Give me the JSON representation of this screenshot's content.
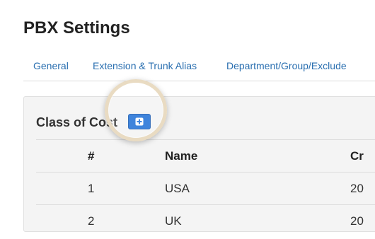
{
  "page": {
    "title": "PBX Settings"
  },
  "tabs": [
    {
      "label": "General"
    },
    {
      "label": "Extension & Trunk Alias"
    },
    {
      "label": "Department/Group/Exclude"
    }
  ],
  "panel": {
    "title": "Class of Cost",
    "add_button_icon": "plus-square-icon"
  },
  "table": {
    "headers": [
      "#",
      "Name",
      "Cr"
    ],
    "rows": [
      {
        "num": "1",
        "name": "USA",
        "created": "20"
      },
      {
        "num": "2",
        "name": "UK",
        "created": "20"
      }
    ]
  },
  "colors": {
    "link": "#2a6fb0",
    "button": "#1e6fd6",
    "panel_bg": "#f4f4f4"
  }
}
